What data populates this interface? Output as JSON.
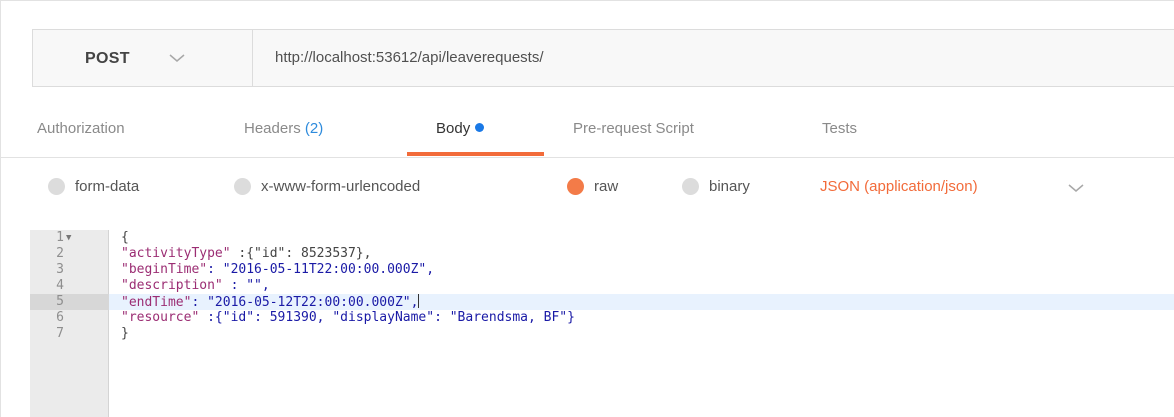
{
  "request": {
    "method": "POST",
    "url": "http://localhost:53612/api/leaverequests/"
  },
  "tabs": [
    {
      "label": "Authorization",
      "count": ""
    },
    {
      "label": "Headers",
      "count": "(2)"
    },
    {
      "label": "Body",
      "count": ""
    },
    {
      "label": "Pre-request Script",
      "count": ""
    },
    {
      "label": "Tests",
      "count": ""
    }
  ],
  "active_tab": "Body",
  "body_types": [
    {
      "label": "form-data",
      "checked": false
    },
    {
      "label": "x-www-form-urlencoded",
      "checked": false
    },
    {
      "label": "raw",
      "checked": true
    },
    {
      "label": "binary",
      "checked": false
    }
  ],
  "content_type": "JSON (application/json)",
  "editor": {
    "active_line": 5,
    "lines": [
      {
        "n": "1",
        "text": "{"
      },
      {
        "n": "2",
        "key": "\"activityType\"",
        "rest": " :{\"id\": 8523537},"
      },
      {
        "n": "3",
        "key": "\"beginTime\"",
        "rest": ": \"2016-05-11T22:00:00.000Z\","
      },
      {
        "n": "4",
        "key": "\"description\"",
        "rest": " : \"\","
      },
      {
        "n": "5",
        "key": "\"endTime\"",
        "rest": ": \"2016-05-12T22:00:00.000Z\","
      },
      {
        "n": "6",
        "key": "\"resource\"",
        "rest": " :{\"id\": 591390, \"displayName\": \"Barendsma, BF\"}"
      },
      {
        "n": "7",
        "text": "}"
      }
    ]
  },
  "colors": {
    "accent": "#f26b3a",
    "link_blue": "#2e8bdc",
    "json_key": "#9b2d73",
    "json_value": "#1a1aa6"
  }
}
